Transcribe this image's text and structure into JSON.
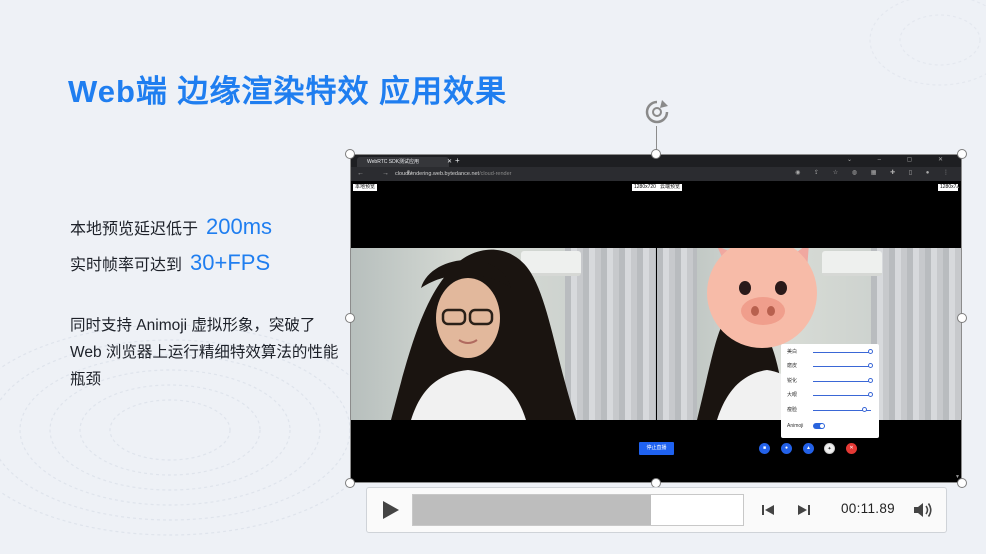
{
  "slide": {
    "title": "Web端 边缘渲染特效 应用效果",
    "stats": [
      {
        "text": "本地预览延迟低于",
        "value": "200ms"
      },
      {
        "text": "实时帧率可达到",
        "value": "30+FPS"
      }
    ],
    "description": "同时支持 Animoji 虚拟形象，突破了 Web 浏览器上运行精细特效算法的性能瓶颈",
    "accent_color": "#1f7ef0"
  },
  "browser": {
    "tab_title": "WebRTC SDK测试应用",
    "url_host": "cloudrendering.web.bytedance.net",
    "url_path": "/cloud-render",
    "labels": {
      "local_preview": "本地预览",
      "local_resolution": "1280x720",
      "cloud_preview": "云端预览",
      "cloud_resolution": "1280x7"
    },
    "stop_button": "停止直播",
    "effects_panel": {
      "sliders": [
        {
          "label": "美白",
          "value": 1.0
        },
        {
          "label": "磨皮",
          "value": 1.0
        },
        {
          "label": "锐化",
          "value": 1.0
        },
        {
          "label": "大眼",
          "value": 1.0
        },
        {
          "label": "瘦脸",
          "value": 0.9
        }
      ],
      "toggle_label": "Animoji",
      "toggle_on": true
    },
    "controls": [
      {
        "icon": "camera-icon",
        "color": "#2361e8"
      },
      {
        "icon": "mic-icon",
        "color": "#2361e8"
      },
      {
        "icon": "share-icon",
        "color": "#2361e8"
      },
      {
        "icon": "effects-icon",
        "color": "#f0f0f0"
      },
      {
        "icon": "hangup-icon",
        "color": "#e53935"
      }
    ]
  },
  "player": {
    "time": "00:11.89",
    "progress": 0.72
  }
}
